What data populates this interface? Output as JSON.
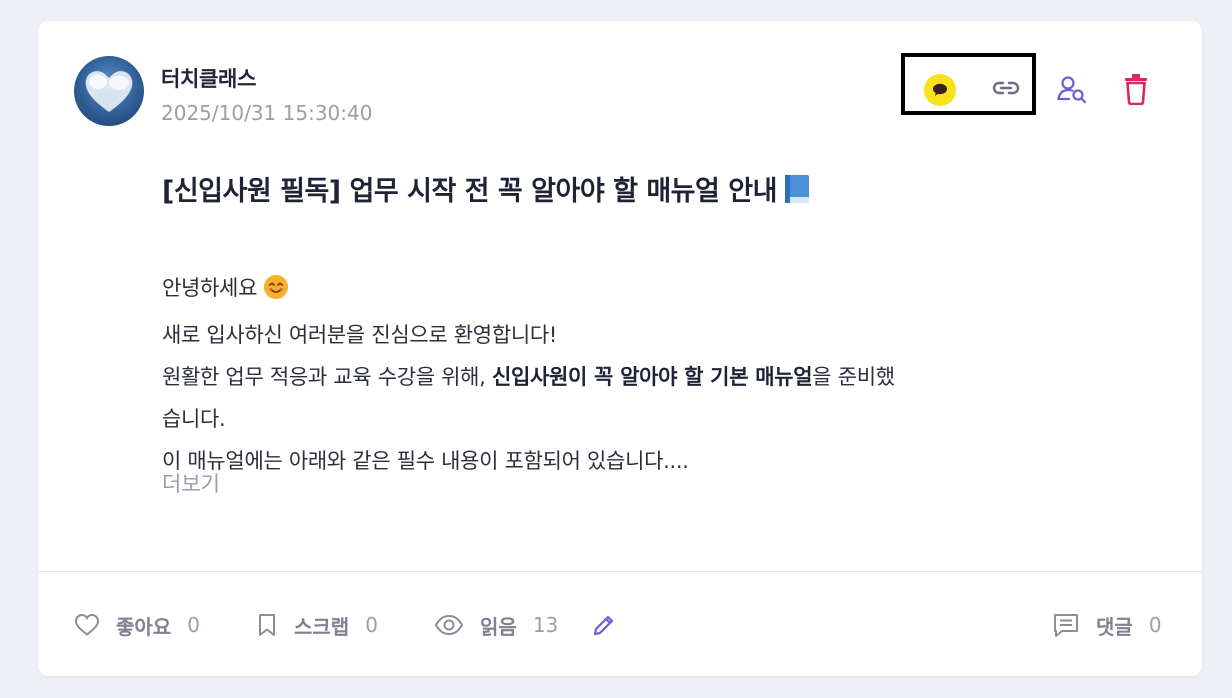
{
  "post": {
    "author": "터치클래스",
    "date": "2025/10/31 15:30:40",
    "title": "[신입사원 필독] 업무 시작 전 꼭 알아야 할 매뉴얼 안내",
    "title_icon": "blue-book-icon",
    "body": {
      "line1": "안녕하세요",
      "line1_icon": "smiling-face-icon",
      "line2": "새로 입사하신 여러분을 진심으로 환영합니다!",
      "line3_pre": "원활한 업무 적응과 교육 수강을 위해, ",
      "line3_bold": "신입사원이 꼭 알아야 할 기본 매뉴얼",
      "line3_post": "을 준비했",
      "line4": "습니다.",
      "line5": "이 매뉴얼에는 아래와 같은 필수 내용이 포함되어 있습니다...."
    },
    "more_label": "더보기"
  },
  "actions": {
    "share_kakao_icon": "kakao-talk-icon",
    "copy_link_icon": "link-icon",
    "view_readers_icon": "person-search-icon",
    "delete_icon": "trash-icon"
  },
  "footer": {
    "like_label": "좋아요",
    "like_count": "0",
    "scrap_label": "스크랩",
    "scrap_count": "0",
    "read_label": "읽음",
    "read_count": "13",
    "comment_label": "댓글",
    "comment_count": "0"
  },
  "colors": {
    "accent": "#6a5fd6",
    "danger": "#e0245e",
    "kakao": "#f7e21b",
    "highlight_box": "#000000"
  }
}
